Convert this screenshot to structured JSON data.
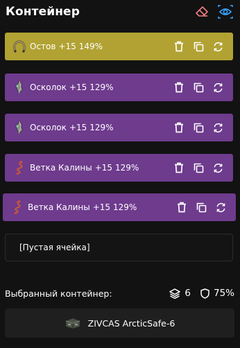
{
  "header": {
    "title": "Контейнер"
  },
  "slots": [
    {
      "name": "Остов",
      "level": "+15",
      "percent": "149%",
      "color": "#b1a233",
      "icon": "horseshoe-icon"
    },
    {
      "name": "Осколок",
      "level": "+15",
      "percent": "129%",
      "color": "#6e3b8d",
      "icon": "shard-icon"
    },
    {
      "name": "Осколок",
      "level": "+15",
      "percent": "129%",
      "color": "#6e3b8d",
      "icon": "shard-icon"
    },
    {
      "name": "Ветка Калины",
      "level": "+15",
      "percent": "129%",
      "color": "#6e3b8d",
      "icon": "branch-icon"
    },
    {
      "name": "Ветка Калины",
      "level": "+15",
      "percent": "129%",
      "color": "#6e3b8d",
      "icon": "branch-icon"
    }
  ],
  "empty_slot": {
    "label": "[Пустая ячейка]"
  },
  "selected": {
    "label": "Выбранный контейнер:",
    "capacity": "6",
    "protection": "75%"
  },
  "container": {
    "name": "ZIVCAS ArcticSafe-6",
    "icon": "safe-box-icon"
  },
  "colors": {
    "accent": "#35a3ff",
    "eraser": "#f07e7e",
    "legendary": "#b1a233",
    "epic": "#6e3b8d"
  }
}
